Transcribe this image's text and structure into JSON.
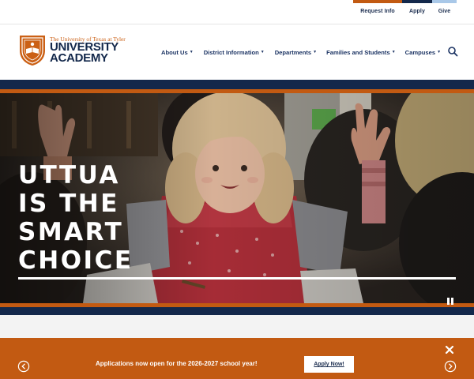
{
  "colors": {
    "navy": "#13284b",
    "orange": "#c25a12",
    "brand_orange": "#cb6015",
    "light_blue": "#a9c8e8",
    "white": "#ffffff"
  },
  "utility_nav": {
    "items": [
      {
        "label": "Request Info",
        "bar_color": "#c25a12"
      },
      {
        "label": "Apply",
        "bar_color": "#13284b"
      },
      {
        "label": "Give",
        "bar_color": "#a9c8e8"
      }
    ]
  },
  "logo": {
    "small_text": "The University of Texas at Tyler",
    "line1": "UNIVERSITY",
    "line2": "ACADEMY"
  },
  "main_nav": {
    "items": [
      {
        "label": "About Us",
        "icon": "chevron-down-icon"
      },
      {
        "label": "District Information",
        "icon": "chevron-down-icon"
      },
      {
        "label": "Departments",
        "icon": "chevron-down-icon"
      },
      {
        "label": "Families and Students",
        "icon": "chevron-down-icon"
      },
      {
        "label": "Campuses",
        "icon": "chevron-down-icon"
      }
    ],
    "search_icon": "search-icon"
  },
  "hero": {
    "headline": [
      "UTTUA",
      "IS THE",
      "SMART",
      "CHOICE"
    ],
    "pause_icon": "pause-icon"
  },
  "banner": {
    "message": "Applications now open for the 2026-2027 school year!",
    "button_label": "Apply Now!",
    "close_icon": "close-icon",
    "prev_icon": "arrow-left-circle-icon",
    "next_icon": "arrow-right-circle-icon"
  }
}
